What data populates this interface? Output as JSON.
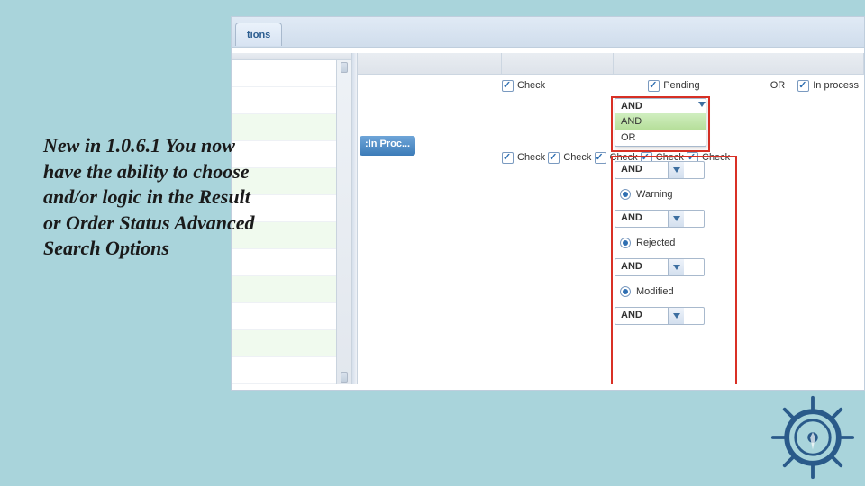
{
  "description": "New in 1.0.6.1 You now have the ability to choose and/or logic in the Result or Order Status Advanced Search Options",
  "tab_label": "tions",
  "filter_text": ":In Proc...",
  "top": {
    "check_label": "Check",
    "pending_label": "Pending",
    "or_text": "OR",
    "inprocess_label": "In process"
  },
  "checks": {
    "label": "Check"
  },
  "combo": {
    "value": "AND",
    "options": [
      "AND",
      "OR"
    ]
  },
  "statuses": {
    "warning": "Warning",
    "rejected": "Rejected",
    "modified": "Modified"
  }
}
